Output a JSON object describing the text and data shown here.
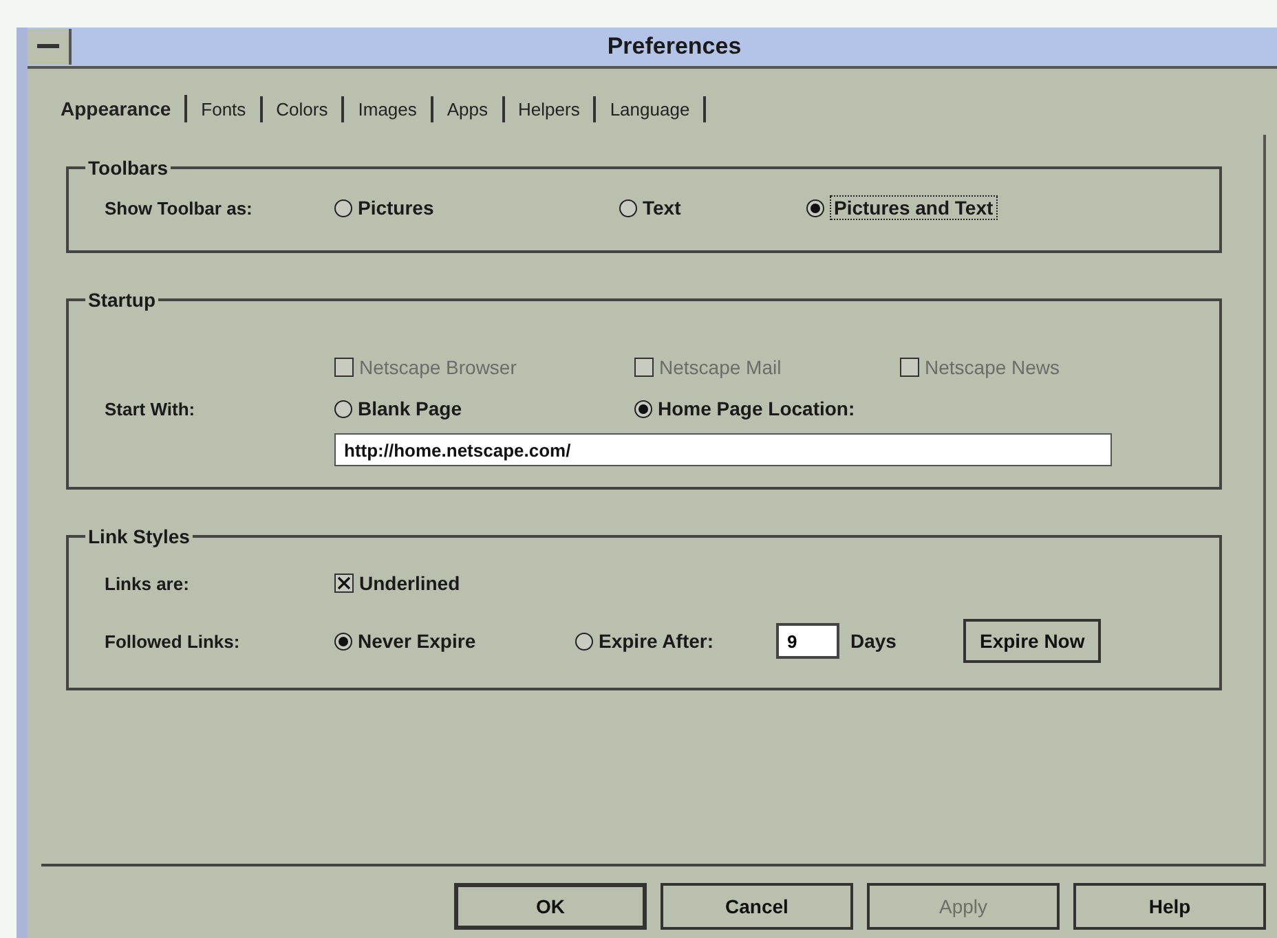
{
  "window": {
    "title": "Preferences"
  },
  "tabs": [
    {
      "label": "Appearance",
      "selected": true
    },
    {
      "label": "Fonts",
      "selected": false
    },
    {
      "label": "Colors",
      "selected": false
    },
    {
      "label": "Images",
      "selected": false
    },
    {
      "label": "Apps",
      "selected": false
    },
    {
      "label": "Helpers",
      "selected": false
    },
    {
      "label": "Language",
      "selected": false
    }
  ],
  "toolbars": {
    "title": "Toolbars",
    "label": "Show Toolbar as:",
    "options": [
      {
        "label": "Pictures",
        "selected": false
      },
      {
        "label": "Text",
        "selected": false
      },
      {
        "label": "Pictures and Text",
        "selected": true
      }
    ]
  },
  "startup": {
    "title": "Startup",
    "checkboxes": [
      {
        "label": "Netscape Browser",
        "checked": false
      },
      {
        "label": "Netscape Mail",
        "checked": false
      },
      {
        "label": "Netscape News",
        "checked": false
      }
    ],
    "label": "Start With:",
    "options": [
      {
        "label": "Blank Page",
        "selected": false
      },
      {
        "label": "Home Page Location:",
        "selected": true
      }
    ],
    "url": "http://home.netscape.com/"
  },
  "link_styles": {
    "title": "Link Styles",
    "links_label": "Links are:",
    "underlined": {
      "label": "Underlined",
      "checked": true
    },
    "followed_label": "Followed Links:",
    "options": [
      {
        "label": "Never Expire",
        "selected": true
      },
      {
        "label": "Expire After:",
        "selected": false
      }
    ],
    "days_value": "9",
    "days_label": "Days",
    "expire_now": "Expire Now"
  },
  "buttons": [
    {
      "label": "OK",
      "default": true,
      "disabled": false
    },
    {
      "label": "Cancel",
      "default": false,
      "disabled": false
    },
    {
      "label": "Apply",
      "default": false,
      "disabled": true
    },
    {
      "label": "Help",
      "default": false,
      "disabled": false
    }
  ]
}
